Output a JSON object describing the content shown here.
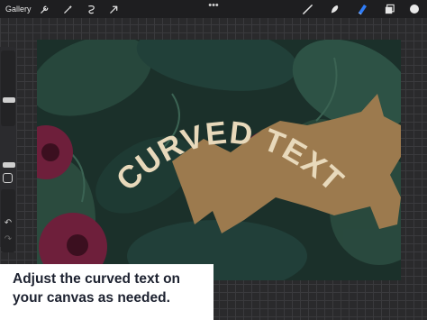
{
  "toolbar": {
    "gallery_label": "Gallery",
    "left_tools": [
      "wrench-icon",
      "magic-wand-icon",
      "selection-icon",
      "transform-arrow-icon"
    ],
    "more_label": "•••",
    "right_tools": [
      "brush-icon",
      "smudge-icon",
      "eraser-icon",
      "layers-icon",
      "color-swatch"
    ],
    "active_tool": "eraser-icon",
    "accent_color": "#2f7cf6",
    "swatch_color": "#e9e9e9"
  },
  "sidebar": {
    "brush_size_level": 0.33,
    "opacity_level": 0.63,
    "undo_icon": "undo-arrow-icon",
    "redo_icon": "redo-arrow-icon"
  },
  "canvas": {
    "curved_text": "CURVED TEXT",
    "text_color": "#e8d9bb",
    "burst_color": "#9c7a4e",
    "background_color": "#1b302a",
    "flower_color": "#6e1f3b"
  },
  "caption": {
    "line1": "Adjust the curved text on",
    "line2": "your canvas as needed."
  }
}
